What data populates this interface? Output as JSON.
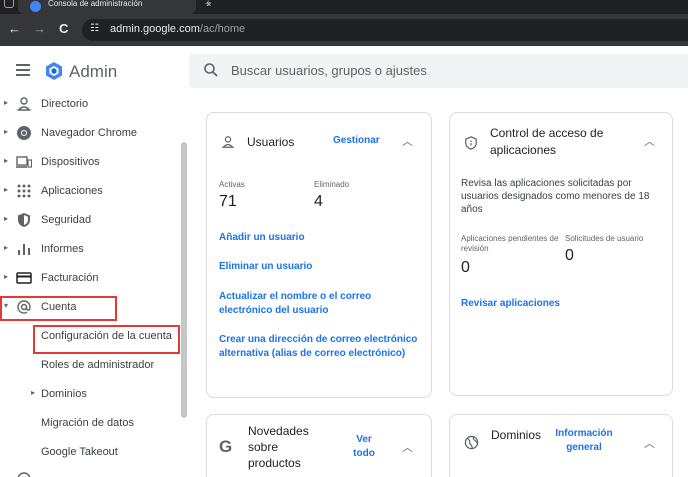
{
  "browser": {
    "tab_title": "Consola de administración",
    "tab_close": "×",
    "new_tab": "+",
    "back": "←",
    "forward": "→",
    "reload": "C",
    "url_host": "admin.google.com",
    "url_path": "/ac/home"
  },
  "header": {
    "app_name": "Admin",
    "search_placeholder": "Buscar usuarios, grupos o ajustes"
  },
  "sidebar": {
    "items": [
      {
        "label": "Directorio",
        "icon": "person-icon"
      },
      {
        "label": "Navegador Chrome",
        "icon": "chrome-icon"
      },
      {
        "label": "Dispositivos",
        "icon": "devices-icon"
      },
      {
        "label": "Aplicaciones",
        "icon": "apps-grid-icon"
      },
      {
        "label": "Seguridad",
        "icon": "shield-icon"
      },
      {
        "label": "Informes",
        "icon": "bar-chart-icon"
      },
      {
        "label": "Facturación",
        "icon": "credit-card-icon"
      },
      {
        "label": "Cuenta",
        "icon": "at-sign-icon"
      }
    ],
    "subitems": [
      {
        "label": "Configuración de la cuenta"
      },
      {
        "label": "Roles de administrador"
      },
      {
        "label": "Dominios"
      },
      {
        "label": "Migración de datos"
      },
      {
        "label": "Google Takeout"
      }
    ]
  },
  "users_card": {
    "title": "Usuarios",
    "manage": "Gestionar",
    "active_label": "Activas",
    "active_value": "71",
    "deleted_label": "Eliminado",
    "deleted_value": "4",
    "links": [
      "Añadir un usuario",
      "Eliminar un usuario",
      "Actualizar el nombre o el correo electrónico del usuario",
      "Crear una dirección de correo electrónico alternativa (alias de correo electrónico)"
    ]
  },
  "app_access_card": {
    "title": "Control de acceso de aplicaciones",
    "description": "Revisa las aplicaciones solicitadas por usuarios designados como menores de 18 años",
    "pending_label": "Aplicaciones pendientes de revisión",
    "pending_value": "0",
    "requests_label": "Solicitudes de usuario",
    "requests_value": "0",
    "review_link": "Revisar aplicaciones"
  },
  "news_card": {
    "title": "Novedades sobre productos",
    "link": "Ver todo"
  },
  "domains_card": {
    "title": "Dominios",
    "link": "Información general"
  }
}
